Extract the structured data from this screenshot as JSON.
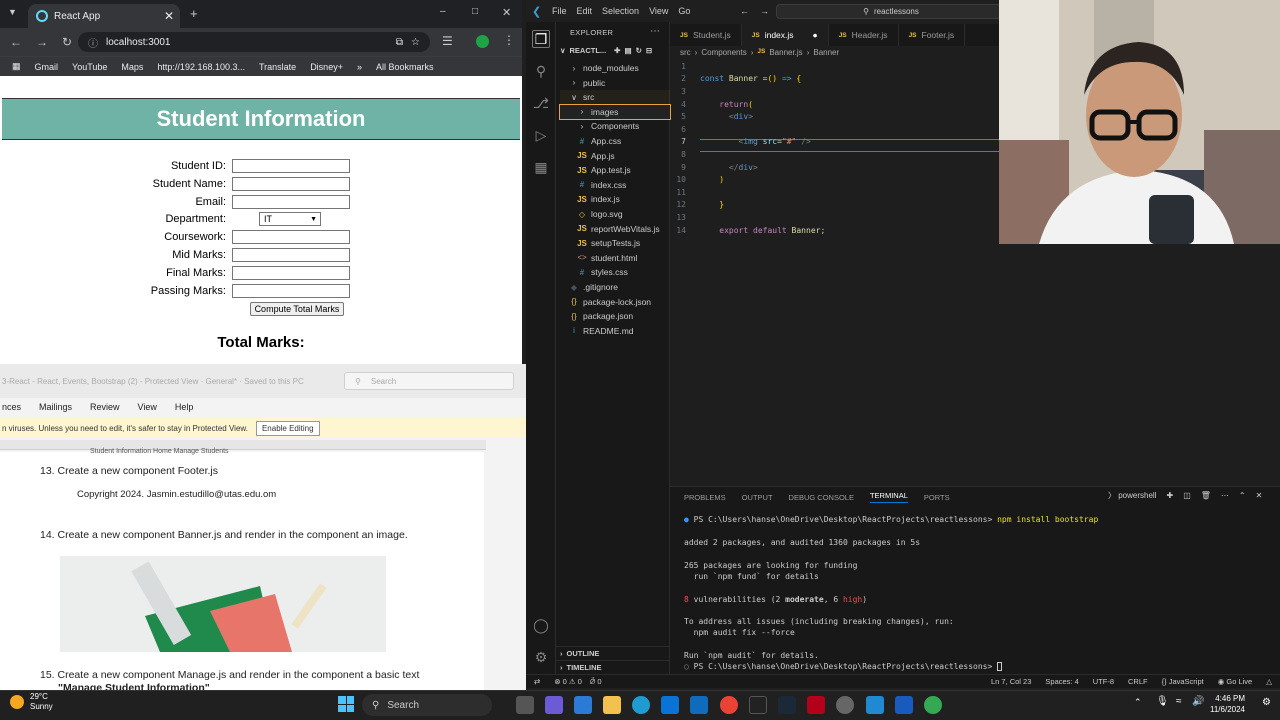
{
  "browser": {
    "tab_title": "React App",
    "url": "localhost:3001",
    "bookmarks": [
      "Gmail",
      "YouTube",
      "Maps",
      "http://192.168.100.3...",
      "Translate",
      "Disney+",
      "All Bookmarks"
    ],
    "page": {
      "banner": "Student Information",
      "form": [
        {
          "label": "Student ID:",
          "type": "text"
        },
        {
          "label": "Student Name:",
          "type": "text"
        },
        {
          "label": "Email:",
          "type": "text"
        },
        {
          "label": "Department:",
          "type": "select",
          "value": "IT"
        },
        {
          "label": "Coursework:",
          "type": "text"
        },
        {
          "label": "Mid Marks:",
          "type": "text"
        },
        {
          "label": "Final Marks:",
          "type": "text"
        },
        {
          "label": "Passing Marks:",
          "type": "text"
        }
      ],
      "compute_button": "Compute Total Marks",
      "total_label": "Total Marks:"
    }
  },
  "word": {
    "title_bar": "3-React - React, Events, Bootstrap (2) - Protected View · General* · Saved to this PC",
    "search_placeholder": "Search",
    "menu": [
      "nces",
      "Mailings",
      "Review",
      "View",
      "Help"
    ],
    "protected_msg": "n viruses. Unless you need to edit, it's safer to stay in Protected View.",
    "enable_editing": "Enable Editing",
    "doc": {
      "header_fragment": "Student Information    Home    Manage Students",
      "item13": "13. Create a new component Footer.js",
      "footer_text": "Copyright 2024. Jasmin.estudillo@utas.edu.om",
      "item14": "14. Create a new component Banner.js and render in the component an image.",
      "item15": "15. Create a new component Manage.js and render in the component a basic text",
      "item15b": "\"Manage Student Information\""
    }
  },
  "vscode": {
    "menu": [
      "File",
      "Edit",
      "Selection",
      "View",
      "Go"
    ],
    "search": "reactlessons",
    "explorer_title": "EXPLORER",
    "project": "REACTL...",
    "tree": [
      {
        "label": "node_modules",
        "kind": "folder",
        "depth": 1
      },
      {
        "label": "public",
        "kind": "folder",
        "depth": 1
      },
      {
        "label": "src",
        "kind": "folder-open",
        "depth": 1
      },
      {
        "label": "images",
        "kind": "folder",
        "depth": 2
      },
      {
        "label": "Components",
        "kind": "folder",
        "depth": 2
      },
      {
        "label": "App.css",
        "kind": "css",
        "depth": 2
      },
      {
        "label": "App.js",
        "kind": "js",
        "depth": 2
      },
      {
        "label": "App.test.js",
        "kind": "js",
        "depth": 2
      },
      {
        "label": "index.css",
        "kind": "css",
        "depth": 2
      },
      {
        "label": "index.js",
        "kind": "js",
        "depth": 2
      },
      {
        "label": "logo.svg",
        "kind": "svg",
        "depth": 2
      },
      {
        "label": "reportWebVitals.js",
        "kind": "js",
        "depth": 2
      },
      {
        "label": "setupTests.js",
        "kind": "js",
        "depth": 2
      },
      {
        "label": "student.html",
        "kind": "html",
        "depth": 2
      },
      {
        "label": "styles.css",
        "kind": "css",
        "depth": 2
      },
      {
        "label": ".gitignore",
        "kind": "git",
        "depth": 1
      },
      {
        "label": "package-lock.json",
        "kind": "json",
        "depth": 1
      },
      {
        "label": "package.json",
        "kind": "json",
        "depth": 1
      },
      {
        "label": "README.md",
        "kind": "md",
        "depth": 1
      }
    ],
    "outline": "OUTLINE",
    "timeline": "TIMELINE",
    "tabs": [
      "Student.js",
      "index.js",
      "Header.js",
      "Footer.js"
    ],
    "breadcrumb": [
      "src",
      "Components",
      "Banner.js",
      "Banner"
    ],
    "code": [
      {
        "n": "1",
        "html": ""
      },
      {
        "n": "2",
        "html": "<span class='kw'>const</span> <span class='fn'>Banner</span> <span class='tx'>=</span><span class='br'>()</span> <span class='kw'>=></span> <span class='br'>{</span>"
      },
      {
        "n": "3",
        "html": ""
      },
      {
        "n": "4",
        "html": "    <span class='kr'>return</span><span class='br'>(</span>"
      },
      {
        "n": "5",
        "html": "      <span class='tag'>&lt;</span><span class='tg'>div</span><span class='tag'>&gt;</span>"
      },
      {
        "n": "6",
        "html": ""
      },
      {
        "n": "7",
        "html": "        <span class='tag'>&lt;</span><span class='tg'>img</span> <span class='attr'>src</span><span class='tx'>=</span><span class='str'>\"#\"</span> <span class='tag'>/&gt;</span>"
      },
      {
        "n": "8",
        "html": ""
      },
      {
        "n": "9",
        "html": "      <span class='tag'>&lt;/</span><span class='tg'>div</span><span class='tag'>&gt;</span>"
      },
      {
        "n": "10",
        "html": "    <span class='br'>)</span>"
      },
      {
        "n": "11",
        "html": ""
      },
      {
        "n": "12",
        "html": "    <span class='br'>}</span>"
      },
      {
        "n": "13",
        "html": ""
      },
      {
        "n": "14",
        "html": "    <span class='kr'>export</span> <span class='kr'>default</span> <span class='fn'>Banner</span><span class='tx'>;</span>"
      }
    ],
    "panel_tabs": [
      "PROBLEMS",
      "OUTPUT",
      "DEBUG CONSOLE",
      "TERMINAL",
      "PORTS"
    ],
    "shell": "powershell",
    "terminal": {
      "prompt1": "PS C:\\Users\\hanse\\OneDrive\\Desktop\\ReactProjects\\reactlessons>",
      "cmd1": "npm install bootstrap",
      "l1": "added 2 packages, and audited 1360 packages in 5s",
      "l2": "265 packages are looking for funding",
      "l3": "  run `npm fund` for details",
      "vuln_num": "8",
      "vuln_a": " vulnerabilities (2 ",
      "vuln_mod": "moderate",
      "vuln_b": ", 6 ",
      "vuln_high": "high",
      "vuln_c": ")",
      "l5": "To address all issues (including breaking changes), run:",
      "l6": "  npm audit fix --force",
      "l7": "Run `npm audit` for details.",
      "prompt2": "PS C:\\Users\\hanse\\OneDrive\\Desktop\\ReactProjects\\reactlessons>"
    },
    "status": {
      "errors": "0",
      "warnings": "0",
      "ports": "0",
      "position": "Ln 7, Col 23",
      "spaces": "Spaces: 4",
      "encoding": "UTF-8",
      "eol": "CRLF",
      "language": "JavaScript",
      "golive": "Go Live"
    }
  },
  "taskbar": {
    "temp": "29°C",
    "weather": "Sunny",
    "search": "Search",
    "time": "4:46 PM",
    "date": "11/6/2024"
  }
}
